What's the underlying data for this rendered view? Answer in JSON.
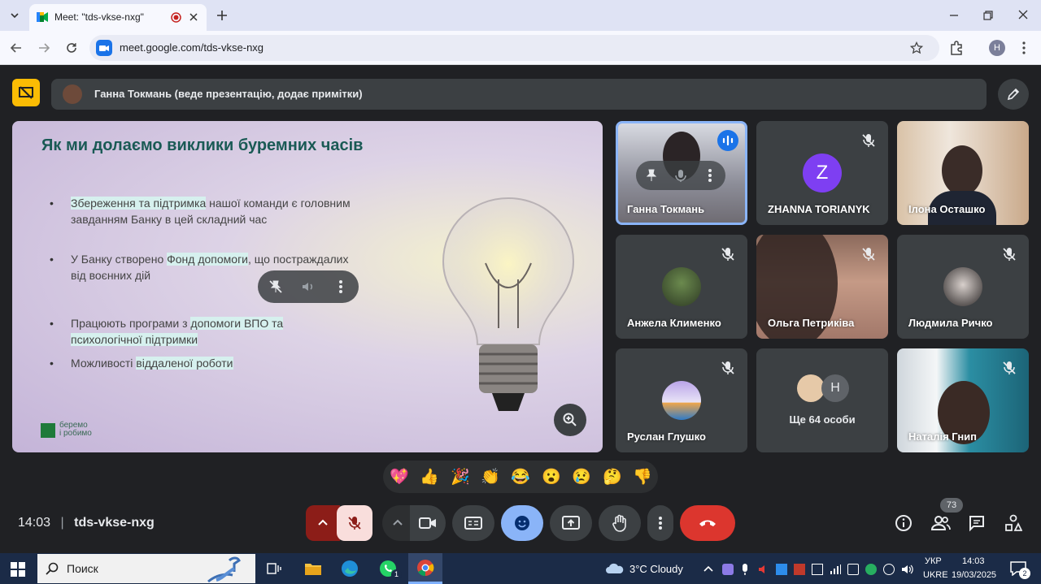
{
  "browser": {
    "tab_title": "Meet: \"tds-vkse-nxg\"",
    "url": "meet.google.com/tds-vkse-nxg",
    "profile_initial": "H"
  },
  "meet": {
    "presenter": "Ганна Токмань (веде презентацію, додає примітки)",
    "time": "14:03",
    "separator": "|",
    "meeting_code": "tds-vkse-nxg",
    "people_count": "73"
  },
  "slide": {
    "title": "Як ми долаємо виклики буремних часів",
    "bullets": [
      [
        "Збереження та підтримка",
        " нашої команди є головним завданням Банку в цей складний час"
      ],
      [
        "У Банку створено ",
        "Фонд допомоги",
        ", що постраждалих від воєнних дій"
      ],
      [
        "Працюють програми з ",
        "допомоги ВПО та психологічної підтримки",
        ""
      ],
      [
        "Можливості ",
        "віддаленої роботи",
        ""
      ]
    ],
    "logo_line1": "беремо",
    "logo_line2": "і робимо"
  },
  "participants": [
    {
      "name": "Ганна Токмань"
    },
    {
      "name": "ZHANNA TORIANYK",
      "initial": "Z"
    },
    {
      "name": "Ілона Осташко"
    },
    {
      "name": "Анжела Клименко"
    },
    {
      "name": "Ольга Петриківа"
    },
    {
      "name": "Людмила Ричко"
    },
    {
      "name": "Руслан Глушко"
    },
    {
      "name": "Ще 64 особи",
      "initial": "H"
    },
    {
      "name": "Наталія Гнип"
    }
  ],
  "reactions": [
    "💖",
    "👍",
    "🎉",
    "👏",
    "😂",
    "😮",
    "😢",
    "🤔",
    "👎"
  ],
  "taskbar": {
    "search": "Поиск",
    "weather": "3°C  Cloudy",
    "lang1": "УКР",
    "lang2": "UKRE",
    "clock_time": "14:03",
    "clock_date": "19/03/2025",
    "whatsapp_badge": "1",
    "notif_count": "2"
  }
}
